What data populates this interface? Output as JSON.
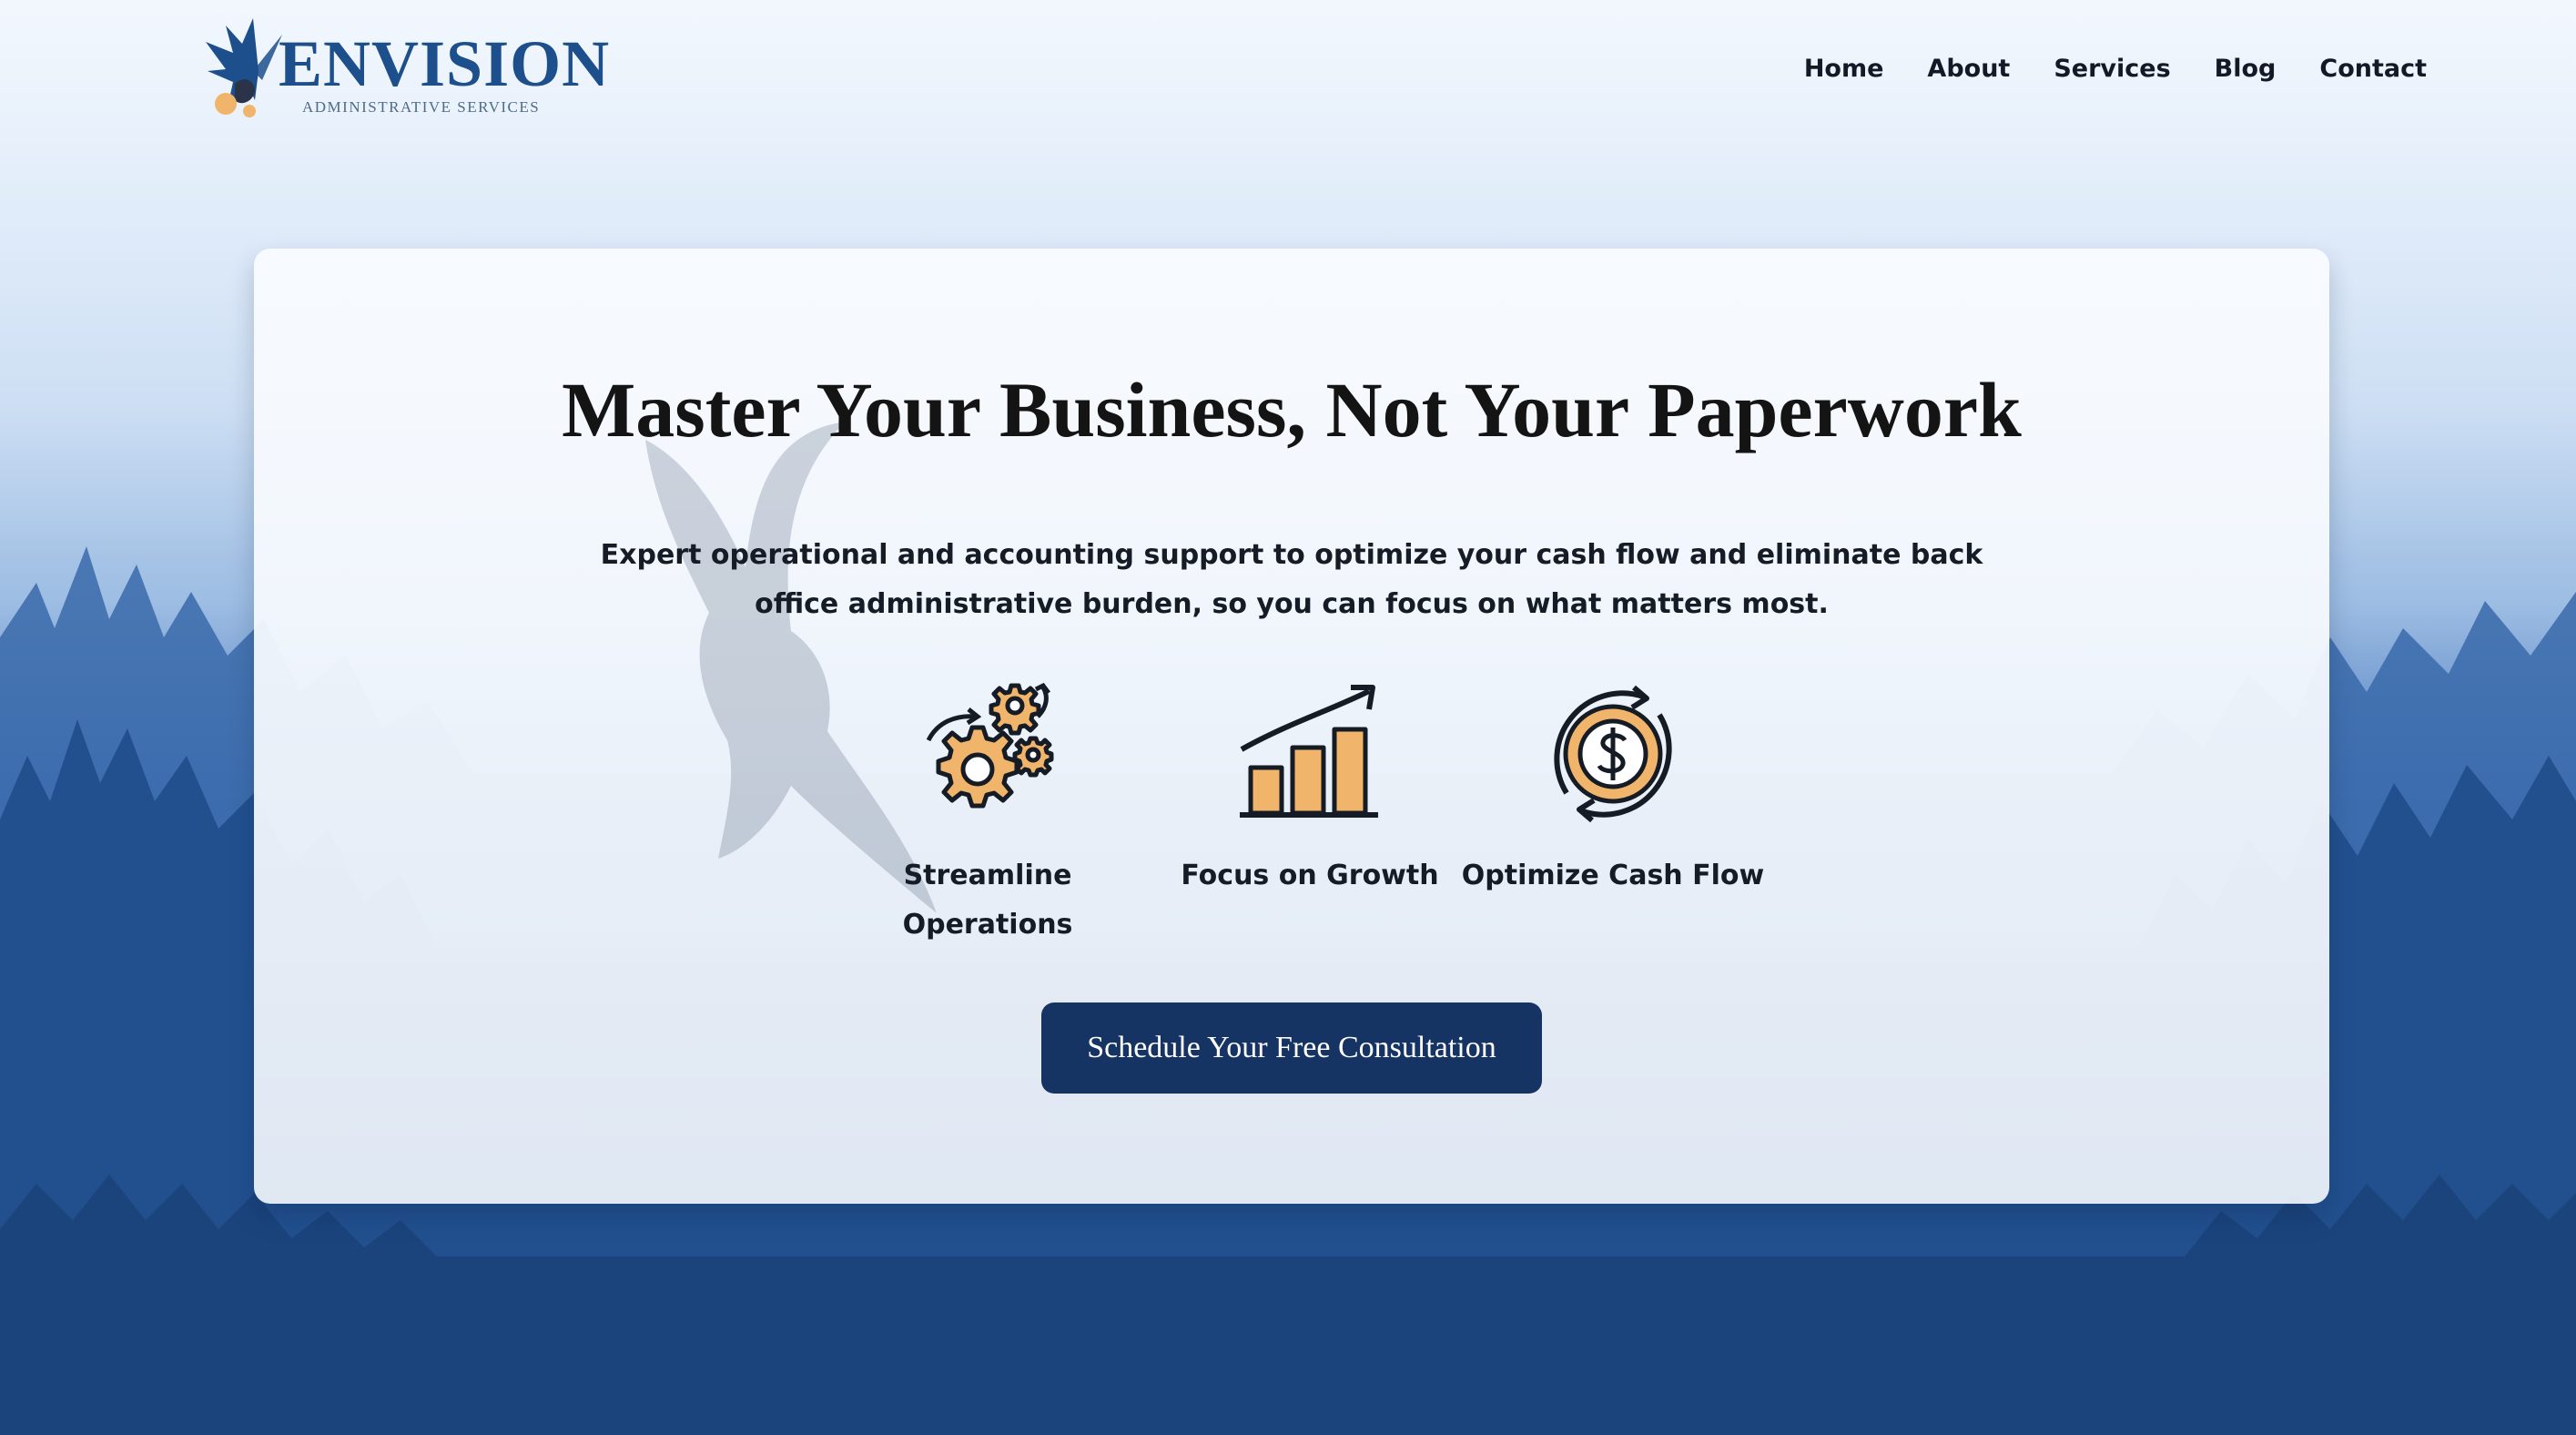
{
  "brand": {
    "name": "ENVISION",
    "tagline": "ADMINISTRATIVE SERVICES"
  },
  "nav": {
    "items": [
      {
        "label": "Home"
      },
      {
        "label": "About"
      },
      {
        "label": "Services"
      },
      {
        "label": "Blog"
      },
      {
        "label": "Contact"
      }
    ]
  },
  "hero": {
    "title": "Master Your Business, Not Your Paperwork",
    "subtitle": "Expert operational and accounting support to optimize your cash flow and eliminate back office administrative burden, so you can focus on what matters most.",
    "features": [
      {
        "icon": "gears-icon",
        "label": "Streamline Operations"
      },
      {
        "icon": "growth-chart-icon",
        "label": "Focus on Growth"
      },
      {
        "icon": "cash-flow-icon",
        "label": "Optimize Cash Flow"
      }
    ],
    "cta_label": "Schedule Your Free Consultation"
  },
  "colors": {
    "brand_blue": "#1d4f8c",
    "cta_navy": "#163463",
    "icon_orange": "#f0b46a",
    "text_dark": "#161c26"
  }
}
